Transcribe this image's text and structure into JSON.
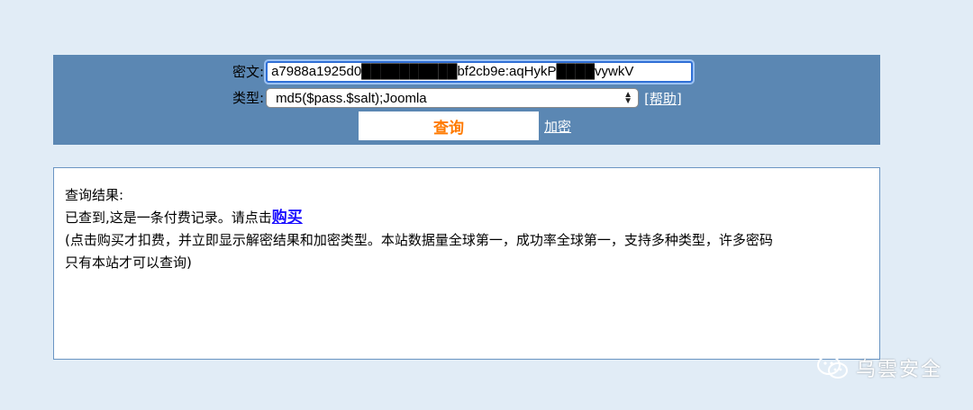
{
  "query_form": {
    "cipher_label": "密文:",
    "cipher_value": "a7988a1925d0██████████bf2cb9e:aqHykP████vywkV",
    "type_label": "类型:",
    "type_selected": "md5($pass.$salt);Joomla",
    "help_link": "[帮助]",
    "submit_label": "查询",
    "encrypt_link": "加密"
  },
  "result": {
    "heading": "查询结果:",
    "line1_text": "已查到,这是一条付费记录。请点击",
    "buy_link": "购买",
    "line2": "(点击购买才扣费，并立即显示解密结果和加密类型。本站数据量全球第一，成功率全球第一，支持多种类型，许多密码",
    "line3": "只有本站才可以查询)"
  },
  "watermark": {
    "text": "乌雲安全",
    "icon": "wechat-icon"
  },
  "colors": {
    "page_background": "#e1ecf6",
    "form_panel": "#5b87b3",
    "submit_text": "#ff7a00",
    "buy_link": "#1a0dff",
    "input_focus": "#2f6fd6"
  }
}
